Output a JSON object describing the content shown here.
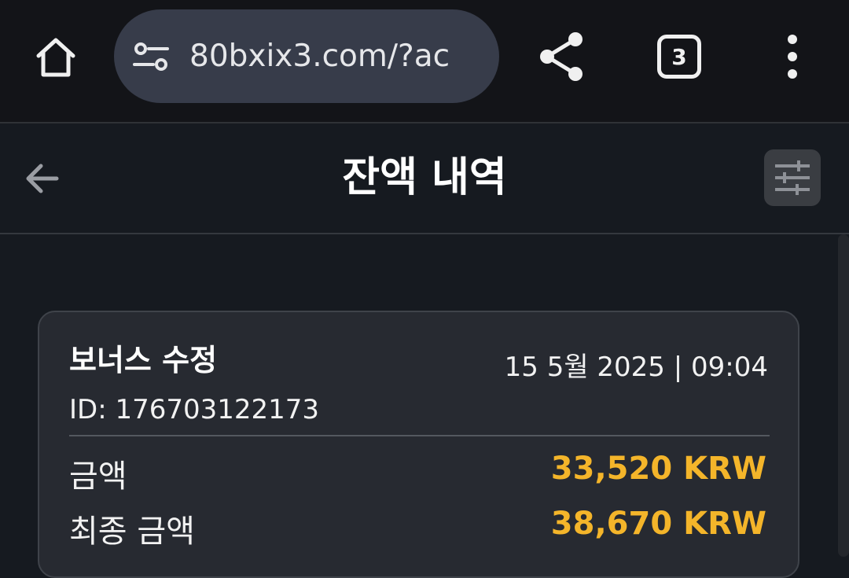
{
  "browser": {
    "url": "80bxix3.com/?ac",
    "tab_count": "3"
  },
  "header": {
    "title": "잔액 내역"
  },
  "card": {
    "title": "보너스 수정",
    "date": "15 5월 2025 | 09:04",
    "id": "ID: 176703122173",
    "rows": [
      {
        "label": "금액",
        "value": "33,520 KRW"
      },
      {
        "label": "최종 금액",
        "value": "38,670 KRW"
      }
    ]
  },
  "colors": {
    "accent": "#f4b52a",
    "background": "#161a20",
    "card": "#272a31"
  }
}
